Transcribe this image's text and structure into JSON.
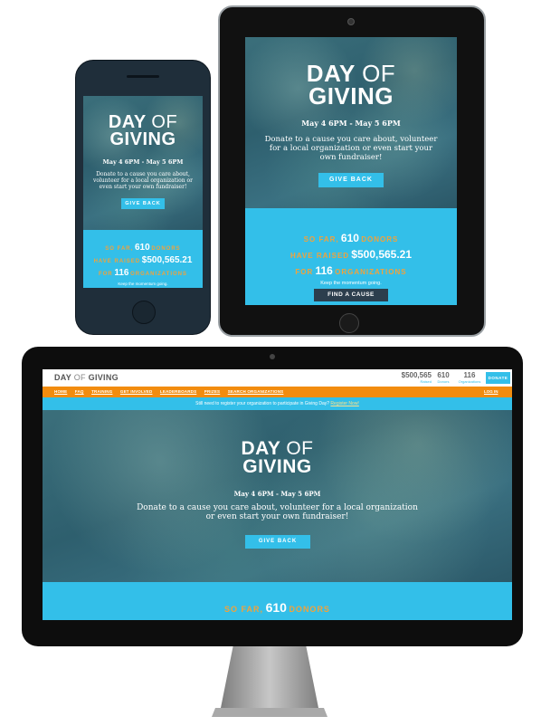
{
  "hero": {
    "title_day": "DAY",
    "title_of": "OF",
    "title_giving": "GIVING",
    "date": "May 4 6PM - May 5 6PM",
    "description": "Donate to a cause you care about, volunteer for a local organization or even start your own fundraiser!",
    "button": "GIVE BACK"
  },
  "stats": {
    "so_far": "SO FAR,",
    "donors_count": "610",
    "donors_label": "DONORS",
    "have_raised": "HAVE RAISED",
    "raised_amount": "$500,565.21",
    "for_label": "FOR",
    "orgs_count": "116",
    "orgs_label": "ORGANIZATIONS",
    "momentum": "Keep the momentum going.",
    "find_cause": "FIND A CAUSE"
  },
  "desktop": {
    "logo_day": "DAY",
    "logo_of": "OF",
    "logo_giving": "GIVING",
    "header_raised": "$500,565",
    "header_raised_label": "Raised",
    "header_donors": "610",
    "header_donors_label": "Donors",
    "header_orgs": "116",
    "header_orgs_label": "Organizations",
    "donate": "DONATE",
    "nav": [
      "HOME",
      "FAQ",
      "TRAINING",
      "GET INVOLVED",
      "LEADERBOARDS",
      "PRIZES",
      "SEARCH ORGANIZATIONS"
    ],
    "login": "LOG IN",
    "notice": "Still need to register your organization to participate in Giving Day?",
    "notice_link": "Register Now!"
  },
  "colors": {
    "accent_blue": "#33bfe9",
    "orange": "#f28c0f",
    "hero_teal": "#2e5f6e",
    "device_dark": "#1f2e3a"
  }
}
